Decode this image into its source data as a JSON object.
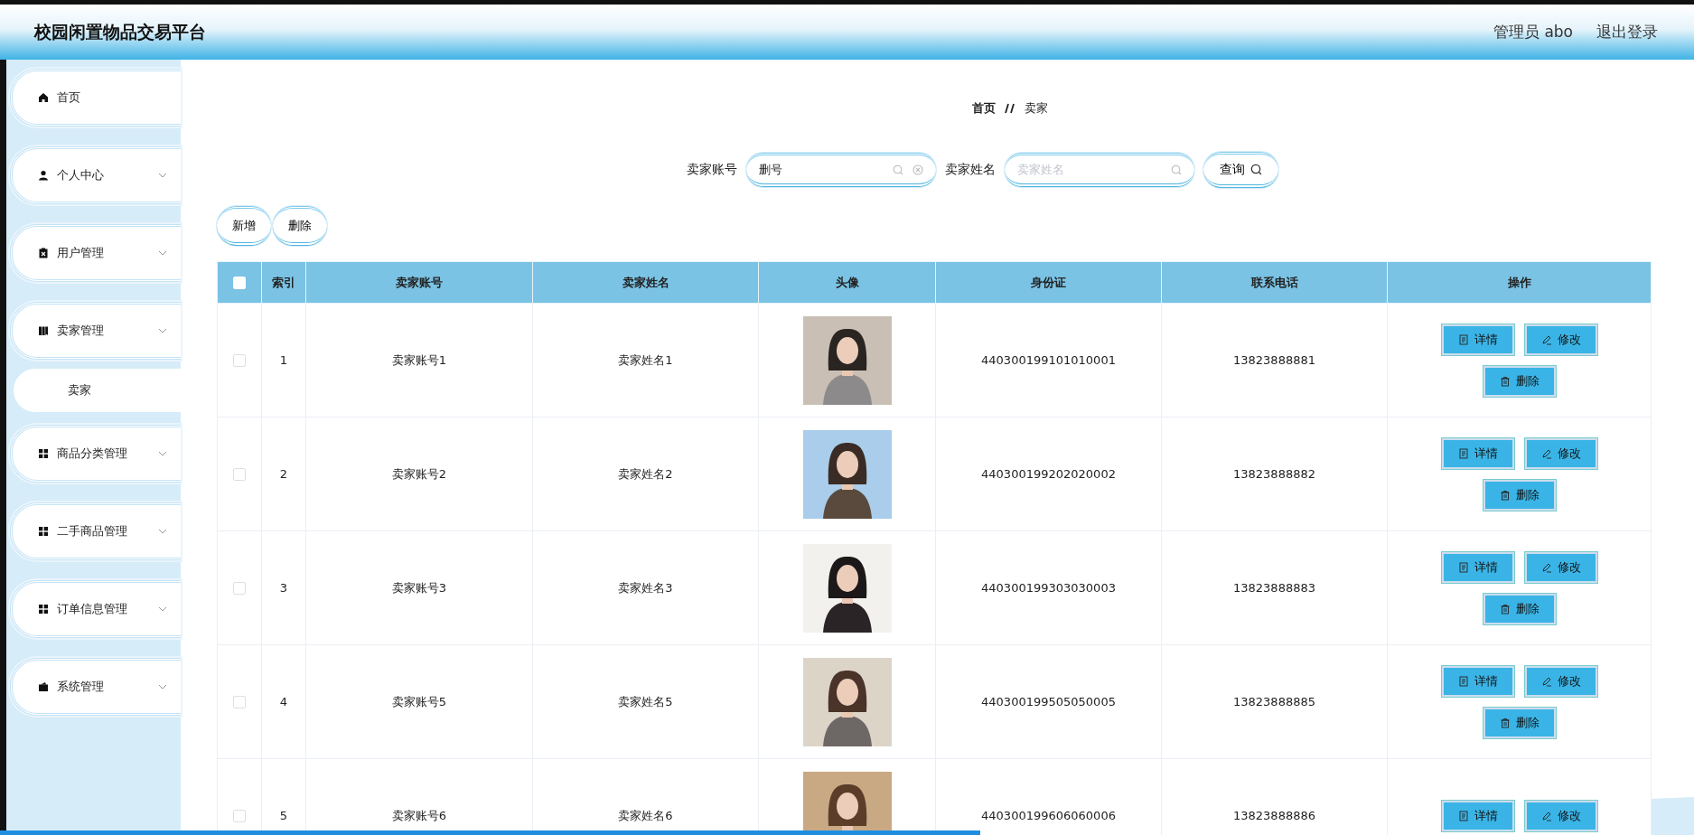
{
  "header": {
    "title": "校园闲置物品交易平台",
    "user": "管理员 abo",
    "logout": "退出登录"
  },
  "sidebar": {
    "items": [
      {
        "label": "首页",
        "kind": "link"
      },
      {
        "label": "个人中心",
        "kind": "menu"
      },
      {
        "label": "用户管理",
        "kind": "menu"
      },
      {
        "label": "卖家管理",
        "kind": "menu",
        "children": [
          {
            "label": "卖家"
          }
        ]
      },
      {
        "label": "商品分类管理",
        "kind": "menu"
      },
      {
        "label": "二手商品管理",
        "kind": "menu"
      },
      {
        "label": "订单信息管理",
        "kind": "menu"
      },
      {
        "label": "系统管理",
        "kind": "menu"
      }
    ]
  },
  "breadcrumb": [
    "首页",
    "卖家"
  ],
  "search": {
    "fields": [
      {
        "label": "卖家账号",
        "value": "删号",
        "clearable": true
      },
      {
        "label": "卖家姓名",
        "placeholder": "卖家姓名",
        "clearable": false
      }
    ],
    "button": "查询"
  },
  "toolbar": [
    "新增",
    "删除"
  ],
  "table": {
    "header_checked": false,
    "columns": [
      "索引",
      "卖家账号",
      "卖家姓名",
      "头像",
      "身份证",
      "联系电话",
      "操作"
    ],
    "rows": [
      {
        "checked": false,
        "index": "1",
        "account": "卖家账号1",
        "name": "卖家姓名1",
        "avatar": {
          "kind": "picture"
        },
        "id_card": "440300199101010001",
        "phone": "13823888881",
        "actions": [
          "详情",
          "修改",
          "删除"
        ]
      },
      {
        "checked": false,
        "index": "2",
        "account": "卖家账号2",
        "name": "卖家姓名2",
        "avatar": {
          "kind": "picture"
        },
        "id_card": "440300199202020002",
        "phone": "13823888882",
        "actions": [
          "详情",
          "修改",
          "删除"
        ]
      },
      {
        "checked": false,
        "index": "3",
        "account": "卖家账号3",
        "name": "卖家姓名3",
        "avatar": {
          "kind": "picture"
        },
        "id_card": "440300199303030003",
        "phone": "13823888883",
        "actions": [
          "详情",
          "修改",
          "删除"
        ]
      },
      {
        "checked": false,
        "index": "4",
        "account": "卖家账号5",
        "name": "卖家姓名5",
        "avatar": {
          "kind": "picture"
        },
        "id_card": "440300199505050005",
        "phone": "13823888885",
        "actions": [
          "详情",
          "修改",
          "删除"
        ]
      },
      {
        "checked": false,
        "index": "5",
        "account": "卖家账号6",
        "name": "卖家姓名6",
        "avatar": {
          "kind": "picture"
        },
        "id_card": "440300199606060006",
        "phone": "13823888886",
        "actions": [
          "详情",
          "修改"
        ]
      }
    ]
  }
}
